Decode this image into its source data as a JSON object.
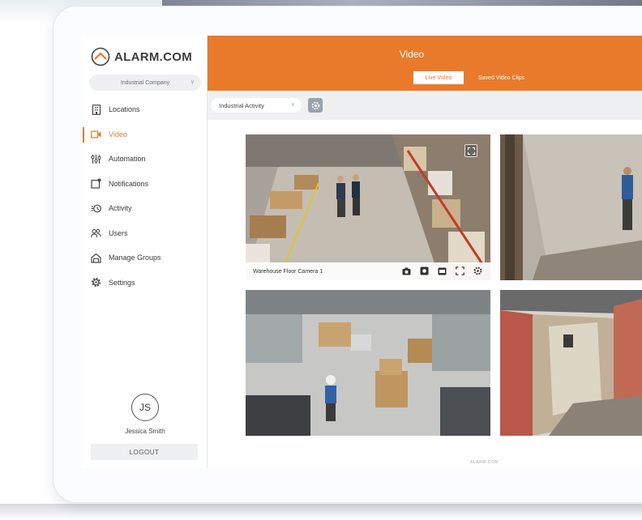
{
  "brand": {
    "logo_text": "ALARM.COM",
    "accent_color": "#ea7a2b"
  },
  "sidebar": {
    "company_select": "Industrial Company",
    "items": [
      {
        "label": "Locations",
        "icon": "building-icon",
        "active": false
      },
      {
        "label": "Video",
        "icon": "video-camera-icon",
        "active": true
      },
      {
        "label": "Automation",
        "icon": "automation-icon",
        "active": false
      },
      {
        "label": "Notifications",
        "icon": "bell-icon",
        "active": false
      },
      {
        "label": "Activity",
        "icon": "activity-icon",
        "active": false
      },
      {
        "label": "Users",
        "icon": "users-icon",
        "active": false
      },
      {
        "label": "Manage Groups",
        "icon": "home-group-icon",
        "active": false
      },
      {
        "label": "Settings",
        "icon": "gear-icon",
        "active": false
      }
    ],
    "user": {
      "initials": "JS",
      "name": "Jessica Smith"
    },
    "logout_label": "LOGOUT"
  },
  "header": {
    "title": "Video",
    "tabs": [
      {
        "label": "Live Video",
        "active": true
      },
      {
        "label": "Saved Video Clips",
        "active": false
      }
    ]
  },
  "toolbar": {
    "group_select": "Industrial Activity"
  },
  "cameras": [
    {
      "name": "Warehouse Floor Camera 1",
      "icons": [
        "camera-snapshot-icon",
        "record-icon",
        "clip-icon",
        "fullscreen-icon",
        "gear-icon"
      ]
    },
    {
      "name": ""
    },
    {
      "name": ""
    },
    {
      "name": ""
    }
  ],
  "footer": {
    "logo_text": "ALARM.COM"
  }
}
